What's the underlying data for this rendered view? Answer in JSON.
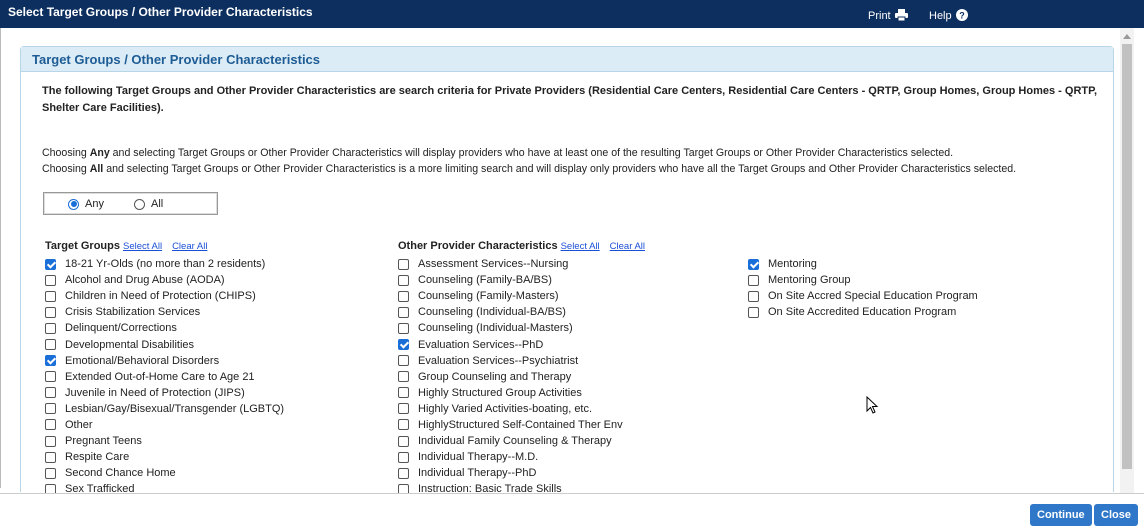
{
  "window": {
    "title": "Select Target Groups / Other Provider Characteristics",
    "print_label": "Print",
    "help_label": "Help"
  },
  "panel": {
    "heading": "Target Groups / Other Provider Characteristics",
    "intro": "The following Target Groups and Other Provider Characteristics are search criteria for Private Providers (Residential Care Centers, Residential Care Centers - QRTP, Group Homes, Group Homes - QRTP, Shelter Care Facilities).",
    "desc": {
      "line1_pre": "Choosing ",
      "line1_bold": "Any",
      "line1_post": " and selecting Target Groups or Other Provider Characteristics will display providers who have at least one of the resulting Target Groups or Other Provider Characteristics selected.",
      "line2_pre": "Choosing ",
      "line2_bold": "All",
      "line2_post": " and selecting Target Groups or Other Provider Characteristics is a more limiting search and will display only providers who have all the Target Groups and Other Provider Characteristics selected."
    },
    "match_mode": {
      "any_label": "Any",
      "all_label": "All",
      "selected": "Any"
    }
  },
  "target_groups": {
    "title": "Target Groups",
    "select_all": "Select All",
    "clear_all": "Clear All",
    "items": [
      {
        "label": "18-21 Yr-Olds (no more than 2 residents)",
        "checked": true
      },
      {
        "label": "Alcohol and Drug Abuse (AODA)",
        "checked": false
      },
      {
        "label": "Children in Need of Protection (CHIPS)",
        "checked": false
      },
      {
        "label": "Crisis Stabilization Services",
        "checked": false
      },
      {
        "label": "Delinquent/Corrections",
        "checked": false
      },
      {
        "label": "Developmental Disabilities",
        "checked": false
      },
      {
        "label": "Emotional/Behavioral Disorders",
        "checked": true
      },
      {
        "label": "Extended Out-of-Home Care to Age 21",
        "checked": false
      },
      {
        "label": "Juvenile in Need of Protection (JIPS)",
        "checked": false
      },
      {
        "label": "Lesbian/Gay/Bisexual/Transgender (LGBTQ)",
        "checked": false
      },
      {
        "label": "Other",
        "checked": false
      },
      {
        "label": "Pregnant Teens",
        "checked": false
      },
      {
        "label": "Respite Care",
        "checked": false
      },
      {
        "label": "Second Chance Home",
        "checked": false
      },
      {
        "label": "Sex Trafficked",
        "checked": false
      }
    ]
  },
  "other_characteristics": {
    "title": "Other Provider Characteristics",
    "select_all": "Select All",
    "clear_all": "Clear All",
    "items": [
      {
        "label": "Assessment Services--Nursing",
        "checked": false
      },
      {
        "label": "Counseling (Family-BA/BS)",
        "checked": false
      },
      {
        "label": "Counseling (Family-Masters)",
        "checked": false
      },
      {
        "label": "Counseling (Individual-BA/BS)",
        "checked": false
      },
      {
        "label": "Counseling (Individual-Masters)",
        "checked": false
      },
      {
        "label": "Evaluation Services--PhD",
        "checked": true
      },
      {
        "label": "Evaluation Services--Psychiatrist",
        "checked": false
      },
      {
        "label": "Group Counseling and Therapy",
        "checked": false
      },
      {
        "label": "Highly Structured Group Activities",
        "checked": false
      },
      {
        "label": "Highly Varied Activities-boating, etc.",
        "checked": false
      },
      {
        "label": "HighlyStructured Self-Contained Ther Env",
        "checked": false
      },
      {
        "label": "Individual Family Counseling & Therapy",
        "checked": false
      },
      {
        "label": "Individual Therapy--M.D.",
        "checked": false
      },
      {
        "label": "Individual Therapy--PhD",
        "checked": false
      },
      {
        "label": "Instruction: Basic Trade Skills",
        "checked": false
      }
    ],
    "items_col3": [
      {
        "label": "Mentoring",
        "checked": true
      },
      {
        "label": "Mentoring Group",
        "checked": false
      },
      {
        "label": "On Site Accred Special Education Program",
        "checked": false
      },
      {
        "label": "On Site Accredited Education Program",
        "checked": false
      }
    ]
  },
  "footer": {
    "continue_label": "Continue",
    "close_label": "Close"
  },
  "colors": {
    "titlebar": "#0d2f5f",
    "accent": "#1a6ed8",
    "button": "#2e77c9",
    "panel_header": "#dcecf7"
  }
}
